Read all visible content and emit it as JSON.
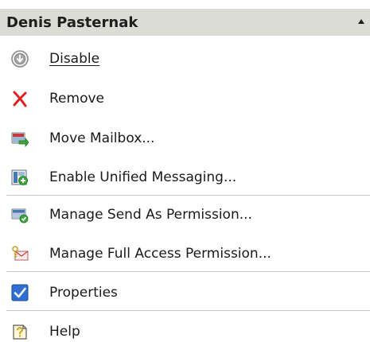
{
  "header": {
    "title": "Denis Pasternak",
    "collapse_icon": "collapse-arrow-icon"
  },
  "actions": [
    {
      "label": "Disable",
      "icon": "disable-icon"
    },
    {
      "label": "Remove",
      "icon": "remove-icon"
    },
    {
      "label": "Move Mailbox...",
      "icon": "move-mailbox-icon"
    },
    {
      "label": "Enable Unified Messaging...",
      "icon": "unified-messaging-icon"
    },
    {
      "label": "Manage Send As Permission...",
      "icon": "send-as-permission-icon"
    },
    {
      "label": "Manage Full Access Permission...",
      "icon": "full-access-permission-icon"
    },
    {
      "label": "Properties",
      "icon": "properties-icon"
    },
    {
      "label": "Help",
      "icon": "help-icon"
    }
  ],
  "colors": {
    "header_bg": "#dcdcd7",
    "remove_red": "#e02020",
    "properties_blue": "#2e6fd1",
    "check_green": "#3aa63a"
  }
}
